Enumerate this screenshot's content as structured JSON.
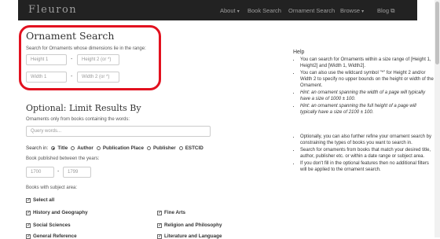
{
  "nav": {
    "brand": "Fleuron",
    "about": "About",
    "book_search": "Book Search",
    "ornament_search": "Ornament Search",
    "browse": "Browse",
    "blog": "Blog"
  },
  "ornament_search": {
    "title": "Ornament Search",
    "desc": "Search for Ornaments whose dimensions lie in the range:",
    "height1_placeholder": "Height 1",
    "height2_placeholder": "Height 2 (or *)",
    "width1_placeholder": "Width 1",
    "width2_placeholder": "Width 2 (or *)",
    "dash": "-"
  },
  "limit": {
    "title": "Optional: Limit Results By",
    "desc": "Ornaments only from books containing the words:",
    "query_placeholder": "Query words...",
    "search_in_label": "Search in:",
    "search_in_options": [
      "Title",
      "Author",
      "Publication Place",
      "Publisher",
      "ESTCID"
    ],
    "search_in_selected": "Title",
    "years_label": "Book published between the years:",
    "year_from": "1700",
    "year_to": "1799",
    "subject_label": "Books with subject area:",
    "subjects": [
      {
        "label": "Select all",
        "checked": true
      },
      {
        "label": "History and Geography",
        "checked": true
      },
      {
        "label": "Fine Arts",
        "checked": true
      },
      {
        "label": "Social Sciences",
        "checked": true
      },
      {
        "label": "Religion and Philosophy",
        "checked": true
      },
      {
        "label": "General Reference",
        "checked": true
      },
      {
        "label": "Literature and Language",
        "checked": true
      }
    ]
  },
  "help": {
    "title": "Help",
    "items1": [
      "You can search for Ornaments within a size range of [Height 1, Height2] and [Width 1, Width2].",
      "You can also use the wildcard symbol \"*\" for Height 2 and/or Width 2 to specify no upper bounds on the height or width of the Ornament.",
      "Hint: an ornament spanning the width of a page will typically have a size of 1000 ± 100.",
      "Hint: an ornament spanning the full height of a page will typically have a size of 2100 ± 100."
    ],
    "items2": [
      "Optionally, you can also further refine your ornament search by constraining the types of books you want to search in.",
      "Search for ornaments from books that match your desired title, author, publisher etc. or within a date range or subject area.",
      "If you don't fill in the optional features then no additional filters will be applied to the ornament search."
    ]
  },
  "colors": {
    "navbar": "#222222",
    "highlight": "#e2111f"
  }
}
